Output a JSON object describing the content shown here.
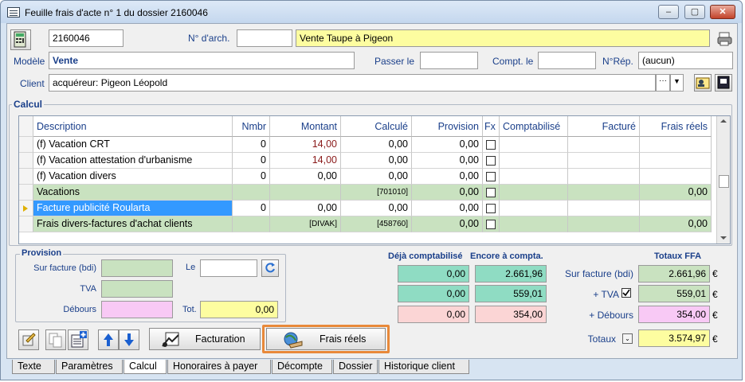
{
  "window": {
    "title": "Feuille frais d'acte n° 1 du dossier 2160046",
    "buttons": [
      "–",
      "▢",
      "✕"
    ]
  },
  "header": {
    "dossier_number": "2160046",
    "archive_label": "N° d'arch.",
    "archive_value": "",
    "description": "Vente Taupe à Pigeon",
    "modele_label": "Modèle",
    "modele_value": "Vente",
    "passer_label": "Passer le",
    "passer_value": "",
    "compt_label": "Compt. le",
    "compt_value": "",
    "nrep_label": "N°Rép.",
    "nrep_value": "(aucun)",
    "client_label": "Client",
    "client_value": "acquéreur: Pigeon Léopold",
    "client_ellipsis": "···",
    "client_dropdown": "▼"
  },
  "calcul": {
    "title": "Calcul",
    "columns": [
      "Description",
      "Nmbr",
      "Montant",
      "Calculé",
      "Provision",
      "Fx",
      "Comptabilisé",
      "Facturé",
      "Frais réels"
    ],
    "rows": [
      {
        "description": "(f) Vacation CRT",
        "nmbr": "0",
        "montant": "14,00",
        "calcule": "0,00",
        "provision": "0,00",
        "comptabilise": "",
        "facture": "",
        "frais_reels": "",
        "style": "plain"
      },
      {
        "description": "(f) Vacation attestation d'urbanisme",
        "nmbr": "0",
        "montant": "14,00",
        "calcule": "0,00",
        "provision": "0,00",
        "comptabilise": "",
        "facture": "",
        "frais_reels": "",
        "style": "plain"
      },
      {
        "description": "(f) Vacation divers",
        "nmbr": "0",
        "montant": "0,00",
        "calcule": "0,00",
        "provision": "0,00",
        "comptabilise": "",
        "facture": "",
        "frais_reels": "",
        "style": "plain"
      },
      {
        "description": "Vacations",
        "nmbr": "",
        "montant": "",
        "calcule": "[701010]",
        "provision": "0,00",
        "comptabilise": "",
        "facture": "",
        "frais_reels": "0,00",
        "style": "green"
      },
      {
        "description": "Facture publicité Roularta",
        "nmbr": "0",
        "montant": "0,00",
        "calcule": "0,00",
        "provision": "0,00",
        "comptabilise": "",
        "facture": "",
        "frais_reels": "",
        "style": "selected"
      },
      {
        "description": "Frais divers-factures d'achat clients",
        "nmbr": "",
        "montant": "[DIVAK]",
        "calcule": "[458760]",
        "provision": "0,00",
        "comptabilise": "",
        "facture": "",
        "frais_reels": "0,00",
        "style": "green"
      }
    ]
  },
  "provision": {
    "title": "Provision",
    "sur_facture_label": "Sur facture (bdi)",
    "sur_facture_value": "",
    "le_label": "Le",
    "le_value": "",
    "tva_label": "TVA",
    "tva_value": "",
    "debours_label": "Débours",
    "debours_value": "",
    "tot_label": "Tot.",
    "tot_value": "0,00"
  },
  "totals": {
    "deja_label": "Déjà comptabilisé",
    "encore_label": "Encore à compta.",
    "ffa_label": "Totaux FFA",
    "deja": [
      "0,00",
      "0,00",
      "0,00"
    ],
    "encore": [
      "2.661,96",
      "559,01",
      "354,00"
    ],
    "sur_facture_label": "Sur facture (bdi)",
    "tva_label": "+ TVA",
    "debours_label": "+ Débours",
    "totaux_label": "Totaux",
    "ffa": [
      "2.661,96",
      "559,01",
      "354,00",
      "3.574,97"
    ],
    "currency": "€"
  },
  "buttons": {
    "facturation": "Facturation",
    "frais_reels": "Frais réels"
  },
  "tabs": [
    "Texte",
    "Paramètres",
    "Calcul",
    "Honoraires à payer",
    "Décompte",
    "Dossier",
    "Historique client"
  ],
  "colors": {
    "accent_highlight": "#e8893a",
    "selection": "#3399ff",
    "subtotal_row": "#c9e2c0"
  }
}
